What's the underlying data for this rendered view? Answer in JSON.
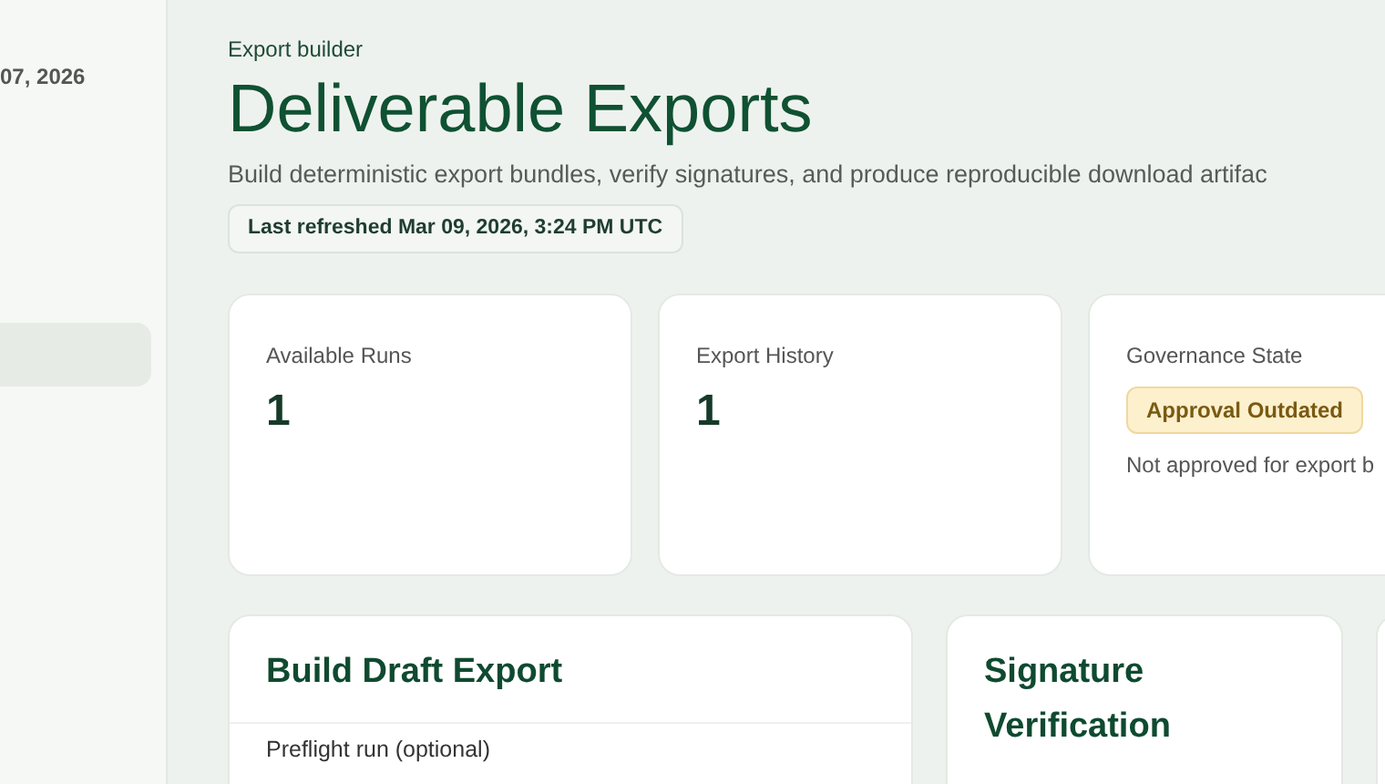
{
  "sidebar": {
    "date": "07, 2026",
    "items": [
      {
        "selected": true
      }
    ]
  },
  "header": {
    "eyebrow": "Export builder",
    "title": "Deliverable Exports",
    "subtitle": "Build deterministic export bundles, verify signatures, and produce reproducible download artifac",
    "refreshed": "Last refreshed Mar 09, 2026, 3:24 PM UTC"
  },
  "stats": [
    {
      "kind": "number",
      "label": "Available Runs",
      "value": "1"
    },
    {
      "kind": "number",
      "label": "Export History",
      "value": "1"
    },
    {
      "kind": "badge",
      "label": "Governance State",
      "badge": "Approval Outdated",
      "note": "Not approved for export b"
    }
  ],
  "panels": [
    {
      "title": "Build Draft Export",
      "field_label": "Preflight run (optional)"
    },
    {
      "title": "Signature Verification"
    }
  ]
}
